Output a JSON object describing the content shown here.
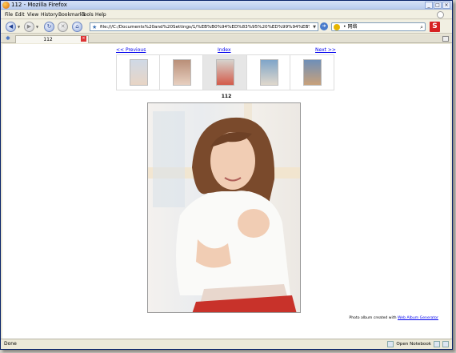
{
  "window": {
    "title": "112 - Mozilla Firefox"
  },
  "menu": [
    "File",
    "Edit",
    "View",
    "History",
    "Bookmarks",
    "Tools",
    "Help"
  ],
  "nav": {
    "back_label": "◀",
    "forward_label": "▶",
    "reload_label": "↻",
    "stop_label": "✕",
    "home_label": "⌂"
  },
  "address": {
    "url": "file:///C:/Documents%20and%20Settings/1/%EB%B0%94%ED%83%95%20%ED%99%94%EB%A9%B4/yumisu"
  },
  "search": {
    "value": "• 网络"
  },
  "tab": {
    "label": "112"
  },
  "gallery": {
    "prev_label": "<< Previous",
    "index_label": "Index",
    "next_label": "Next >>",
    "caption": "112",
    "thumbs": [
      {
        "name": "thumb-1",
        "colors": [
          "#cfd9e6",
          "#e8d5c5"
        ]
      },
      {
        "name": "thumb-2",
        "colors": [
          "#b98f78",
          "#e7cfc0"
        ]
      },
      {
        "name": "thumb-3",
        "colors": [
          "#d6d2cc",
          "#d35a4a"
        ]
      },
      {
        "name": "thumb-4",
        "colors": [
          "#7fa5c9",
          "#e0d8cc"
        ]
      },
      {
        "name": "thumb-5",
        "colors": [
          "#6f8fb8",
          "#c9a17a"
        ]
      }
    ],
    "credit_prefix": "Photo album created with",
    "credit_link": "Web Album Generator"
  },
  "status": {
    "text": "Done",
    "notebook_label": "Open Notebook"
  }
}
